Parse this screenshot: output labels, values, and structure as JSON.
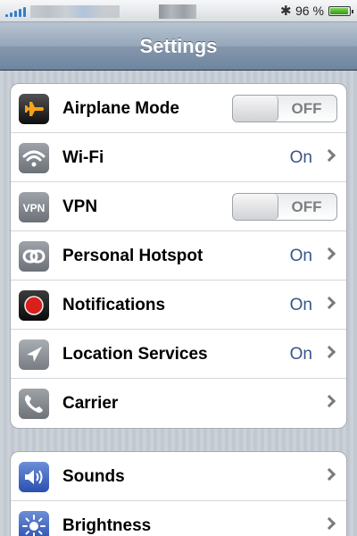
{
  "status_bar": {
    "battery_percent": "96 %",
    "battery_level": 0.96,
    "bluetooth_icon": "bluetooth-icon"
  },
  "nav": {
    "title": "Settings"
  },
  "groups": [
    {
      "items": [
        {
          "icon": "airplane-icon",
          "label": "Airplane Mode",
          "control": "toggle",
          "value": "OFF"
        },
        {
          "icon": "wifi-icon",
          "label": "Wi-Fi",
          "control": "disclosure",
          "value": "On"
        },
        {
          "icon": "vpn-icon",
          "icon_text": "VPN",
          "label": "VPN",
          "control": "toggle",
          "value": "OFF"
        },
        {
          "icon": "hotspot-icon",
          "label": "Personal Hotspot",
          "control": "disclosure",
          "value": "On"
        },
        {
          "icon": "notifications-icon",
          "label": "Notifications",
          "control": "disclosure",
          "value": "On"
        },
        {
          "icon": "location-icon",
          "label": "Location Services",
          "control": "disclosure",
          "value": "On"
        },
        {
          "icon": "phone-icon",
          "label": "Carrier",
          "control": "disclosure",
          "value": ""
        }
      ]
    },
    {
      "items": [
        {
          "icon": "speaker-icon",
          "label": "Sounds",
          "control": "disclosure",
          "value": ""
        },
        {
          "icon": "sun-icon",
          "label": "Brightness",
          "control": "disclosure",
          "value": ""
        }
      ]
    }
  ],
  "colors": {
    "value_blue": "#385487",
    "nav_bar": "#8597ac",
    "background": "#c5ccd4"
  }
}
